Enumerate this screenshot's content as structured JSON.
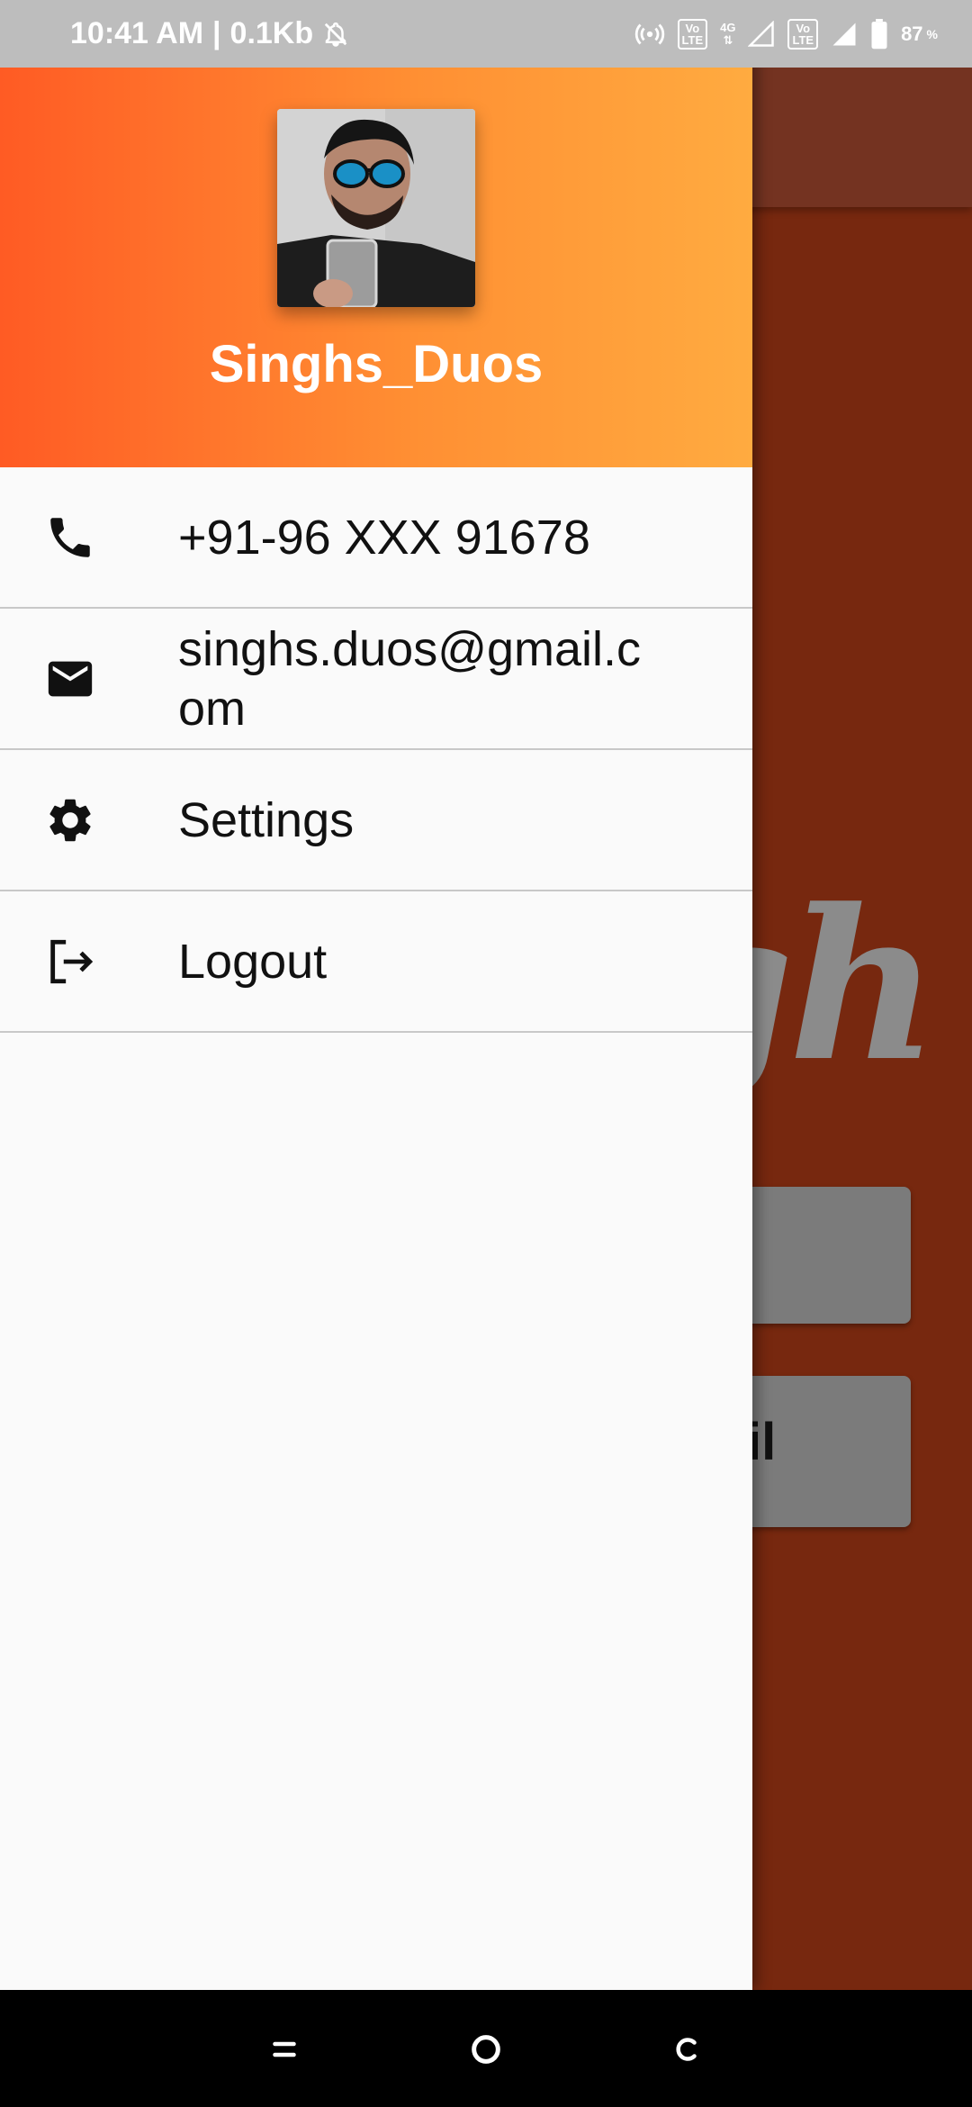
{
  "status_bar": {
    "time": "10:41 AM",
    "separator": "|",
    "data_speed": "0.1Kb",
    "network_label": "4G",
    "volte_label_1": "Vo\nLTE",
    "volte_label_2": "Vo\nLTE",
    "battery_percent": "87",
    "battery_unit": "%",
    "icons": [
      "bell-off-icon",
      "hotspot-icon",
      "signal-icon",
      "battery-icon"
    ]
  },
  "drawer": {
    "user_name": "Singhs_Duos",
    "items": [
      {
        "label": "+91-96 XXX 91678",
        "icon": "phone-icon"
      },
      {
        "label": "singhs.duos@gmail.com",
        "icon": "mail-icon"
      },
      {
        "label": "Settings",
        "icon": "gear-icon"
      },
      {
        "label": "Logout",
        "icon": "logout-icon"
      }
    ]
  },
  "background": {
    "script_text": "ngh",
    "button_2_partial": "il"
  },
  "nav_bar": {
    "icons": [
      "recents-icon",
      "home-icon",
      "back-icon"
    ]
  },
  "colors": {
    "header_gradient_start": "#ff5b24",
    "header_gradient_end": "#ffab40",
    "background_app": "#77280f",
    "drawer_bg": "#fafafa"
  }
}
